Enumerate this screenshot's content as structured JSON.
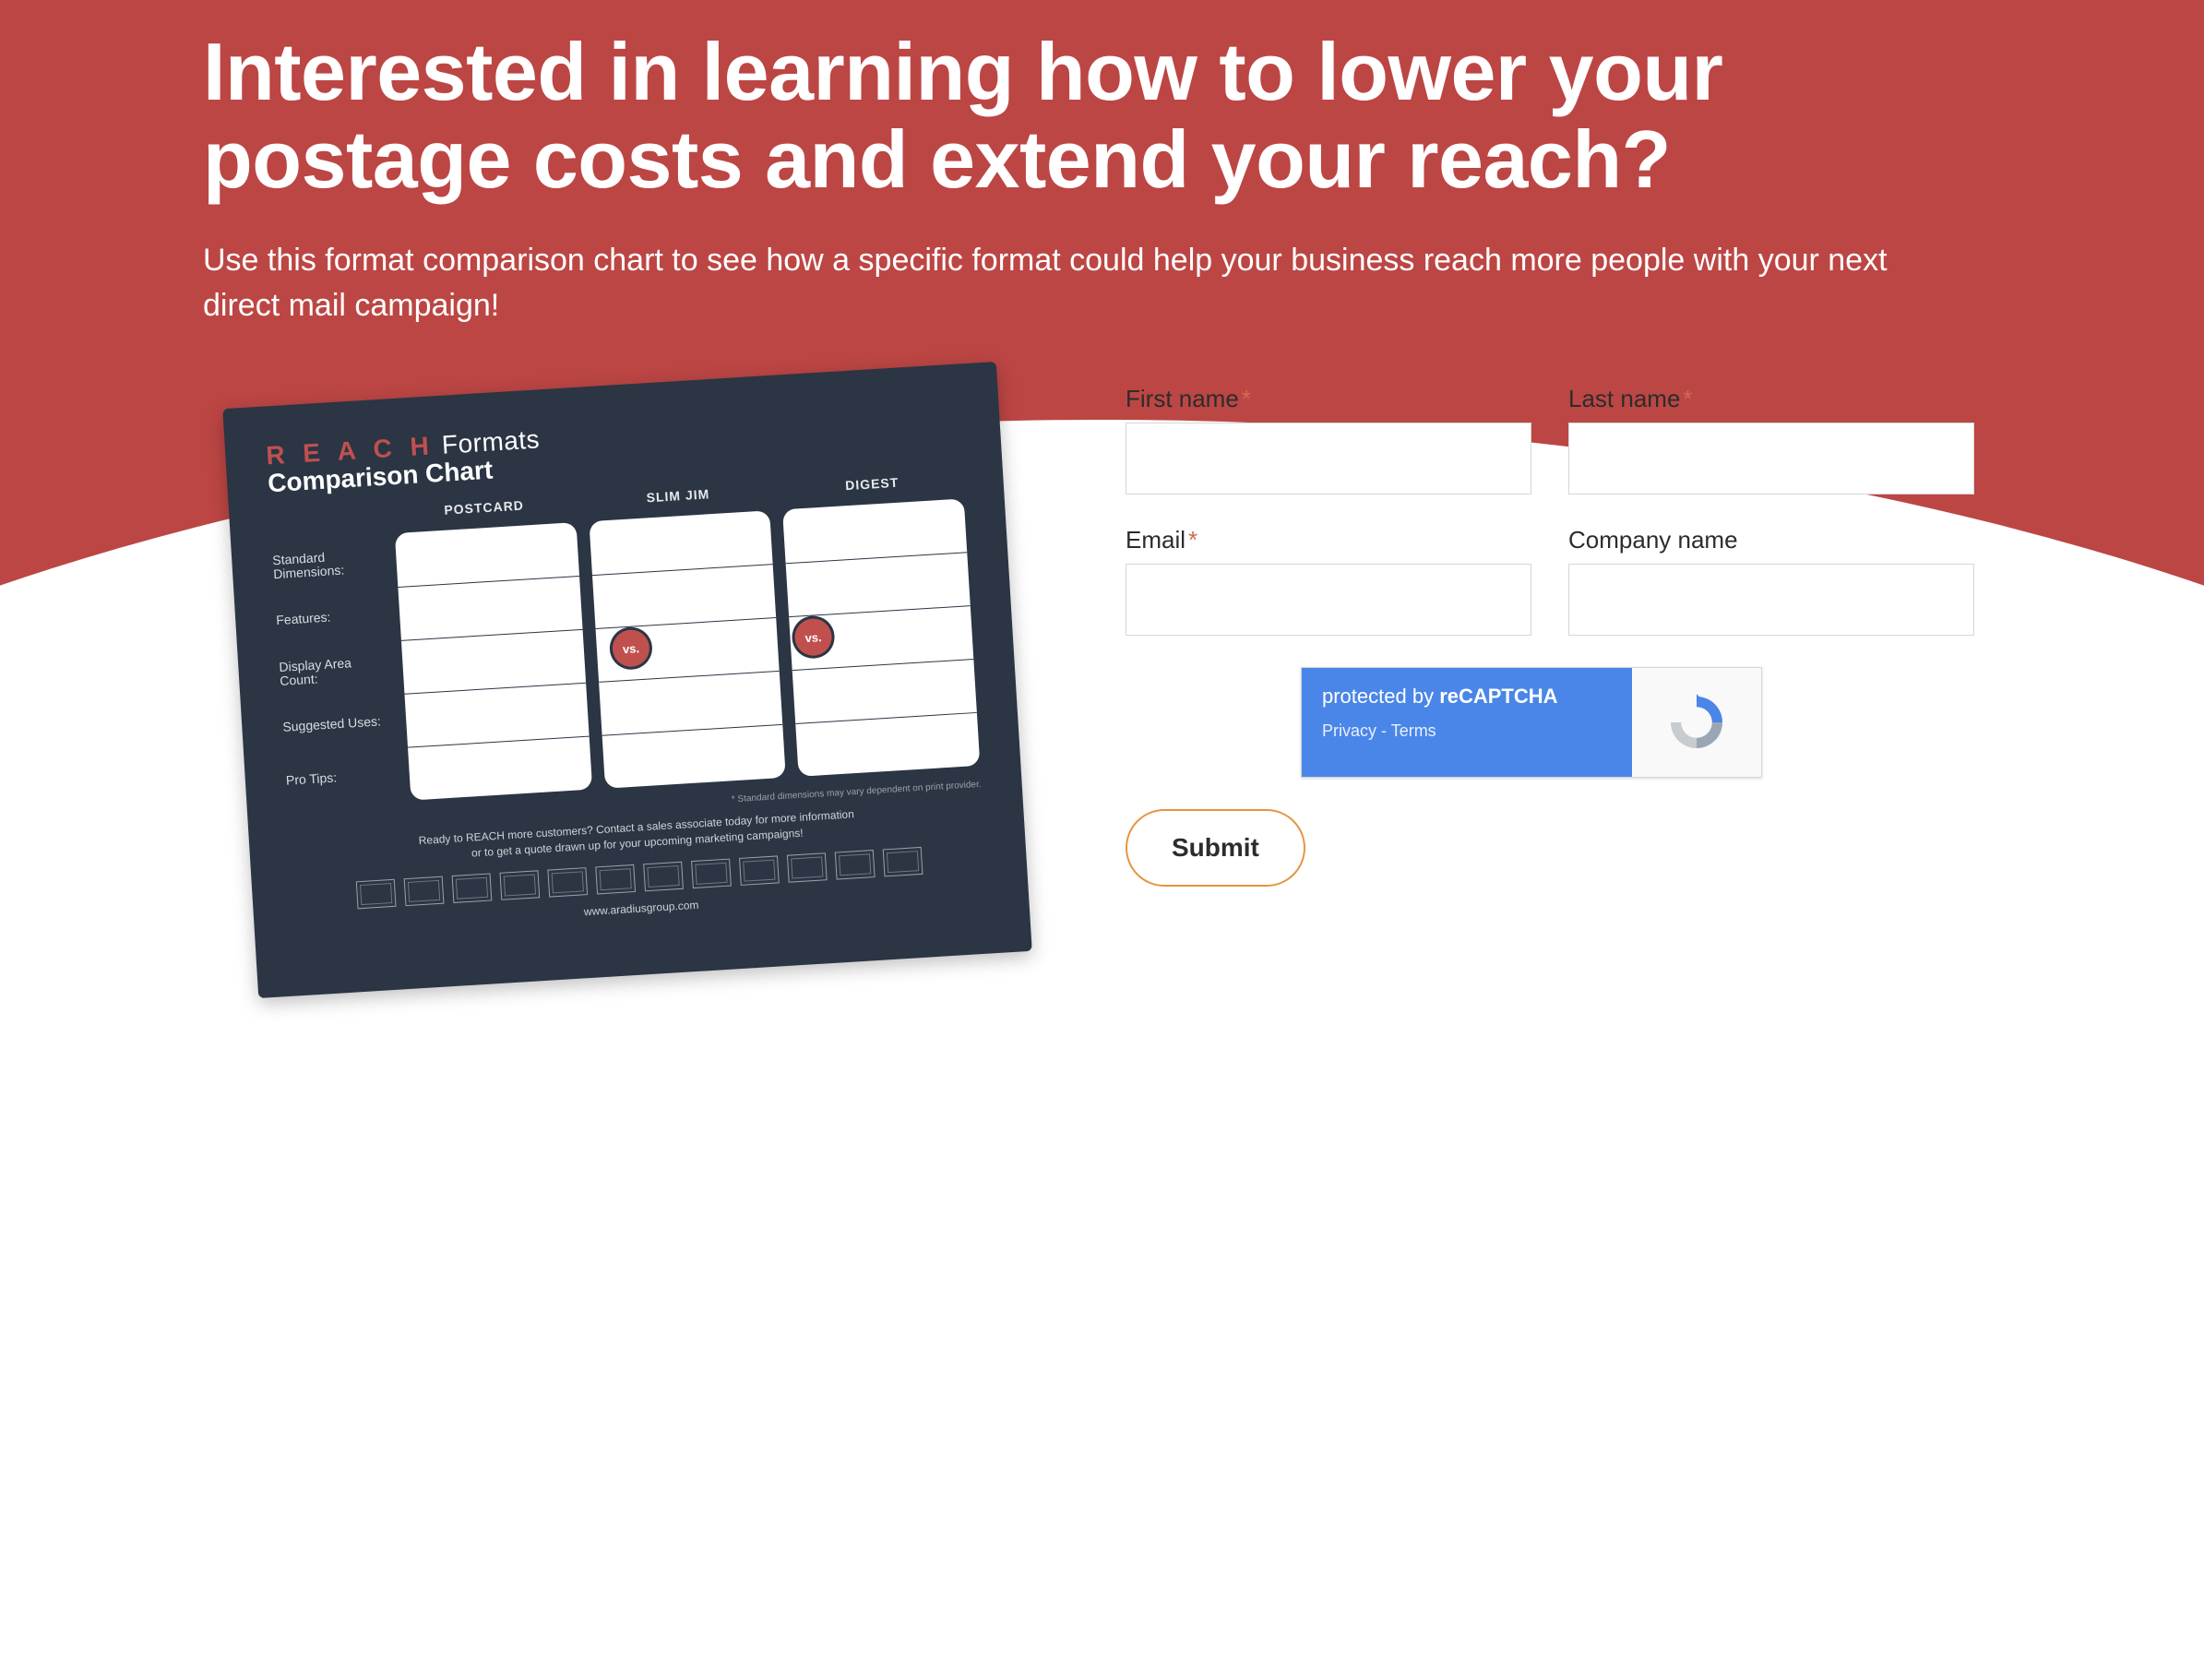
{
  "headline": "Interested in learning how to lower your postage costs and extend your reach?",
  "subhead": "Use this format comparison chart to see how a specific format could help your business reach more people with your next direct mail campaign!",
  "preview": {
    "brand": "R E A C H",
    "title_word": "Formats",
    "title_line2": "Comparison Chart",
    "columns": [
      "POSTCARD",
      "SLIM JIM",
      "DIGEST"
    ],
    "rows": [
      "Standard Dimensions:",
      "Features:",
      "Display Area Count:",
      "Suggested Uses:",
      "Pro Tips:"
    ],
    "vs": "vs.",
    "finenote": "* Standard dimensions may vary dependent on print provider.",
    "cta_line1": "Ready to REACH more customers? Contact a sales associate today for more information",
    "cta_line2": "or to get a quote drawn up for your upcoming marketing campaigns!",
    "url": "www.aradiusgroup.com"
  },
  "form": {
    "first_name": {
      "label": "First name",
      "required": true
    },
    "last_name": {
      "label": "Last name",
      "required": true
    },
    "email": {
      "label": "Email",
      "required": true
    },
    "company": {
      "label": "Company name",
      "required": false
    },
    "recaptcha": {
      "line1_a": "protected by ",
      "line1_b": "reCAPTCHA",
      "privacy": "Privacy",
      "sep": " - ",
      "terms": "Terms"
    },
    "submit": "Submit"
  }
}
